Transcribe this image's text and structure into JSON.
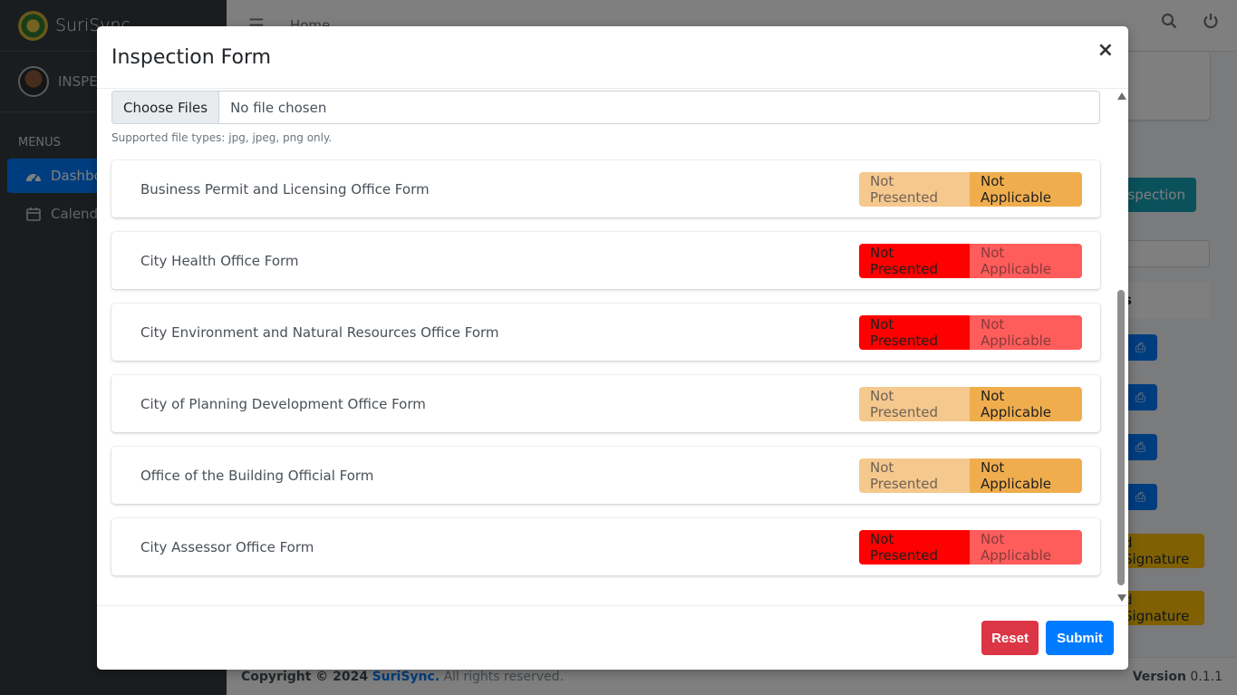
{
  "app": {
    "name": "SuriSync"
  },
  "sidebar": {
    "user_name": "INSPE",
    "menu_header": "MENUS",
    "items": [
      {
        "label": "Dashbo",
        "icon": "dashboard-icon",
        "active": true
      },
      {
        "label": "Calend",
        "icon": "calendar-icon",
        "active": false
      }
    ]
  },
  "topbar": {
    "home_label": "Home"
  },
  "background": {
    "new_inspection_label": "nspection",
    "column_header": "s",
    "signature_label": "d Signature"
  },
  "footer": {
    "copyright_prefix": "Copyright © 2024",
    "brand": "SuriSync.",
    "rights": "All rights reserved.",
    "version_label": "Version",
    "version_value": "0.1.1"
  },
  "modal": {
    "title": "Inspection Form",
    "close_glyph": "×",
    "file_button": "Choose Files",
    "file_status": "No file chosen",
    "file_hint": "Supported file types: jpg, jpeg, png only.",
    "forms": [
      {
        "label": "Business Permit and Licensing Office Form",
        "opt1": "Not Presented",
        "opt2": "Not Applicable",
        "selected": "Not Applicable",
        "theme": "warn"
      },
      {
        "label": "City Health Office Form",
        "opt1": "Not Presented",
        "opt2": "Not Applicable",
        "selected": "Not Presented",
        "theme": "danger"
      },
      {
        "label": "City Environment and Natural Resources Office Form",
        "opt1": "Not Presented",
        "opt2": "Not Applicable",
        "selected": "Not Presented",
        "theme": "danger"
      },
      {
        "label": "City of Planning Development Office Form",
        "opt1": "Not Presented",
        "opt2": "Not Applicable",
        "selected": "Not Applicable",
        "theme": "warn"
      },
      {
        "label": "Office of the Building Official Form",
        "opt1": "Not Presented",
        "opt2": "Not Applicable",
        "selected": "Not Applicable",
        "theme": "warn"
      },
      {
        "label": "City Assessor Office Form",
        "opt1": "Not Presented",
        "opt2": "Not Applicable",
        "selected": "Not Presented",
        "theme": "danger"
      }
    ],
    "reset_label": "Reset",
    "submit_label": "Submit"
  },
  "colors": {
    "primary": "#007bff",
    "danger": "#dc3545",
    "warning_active": "#f0ad4e",
    "warning_dim": "#f5c88d",
    "red_active": "#ff0000",
    "red_dim": "#ff5c5c"
  }
}
